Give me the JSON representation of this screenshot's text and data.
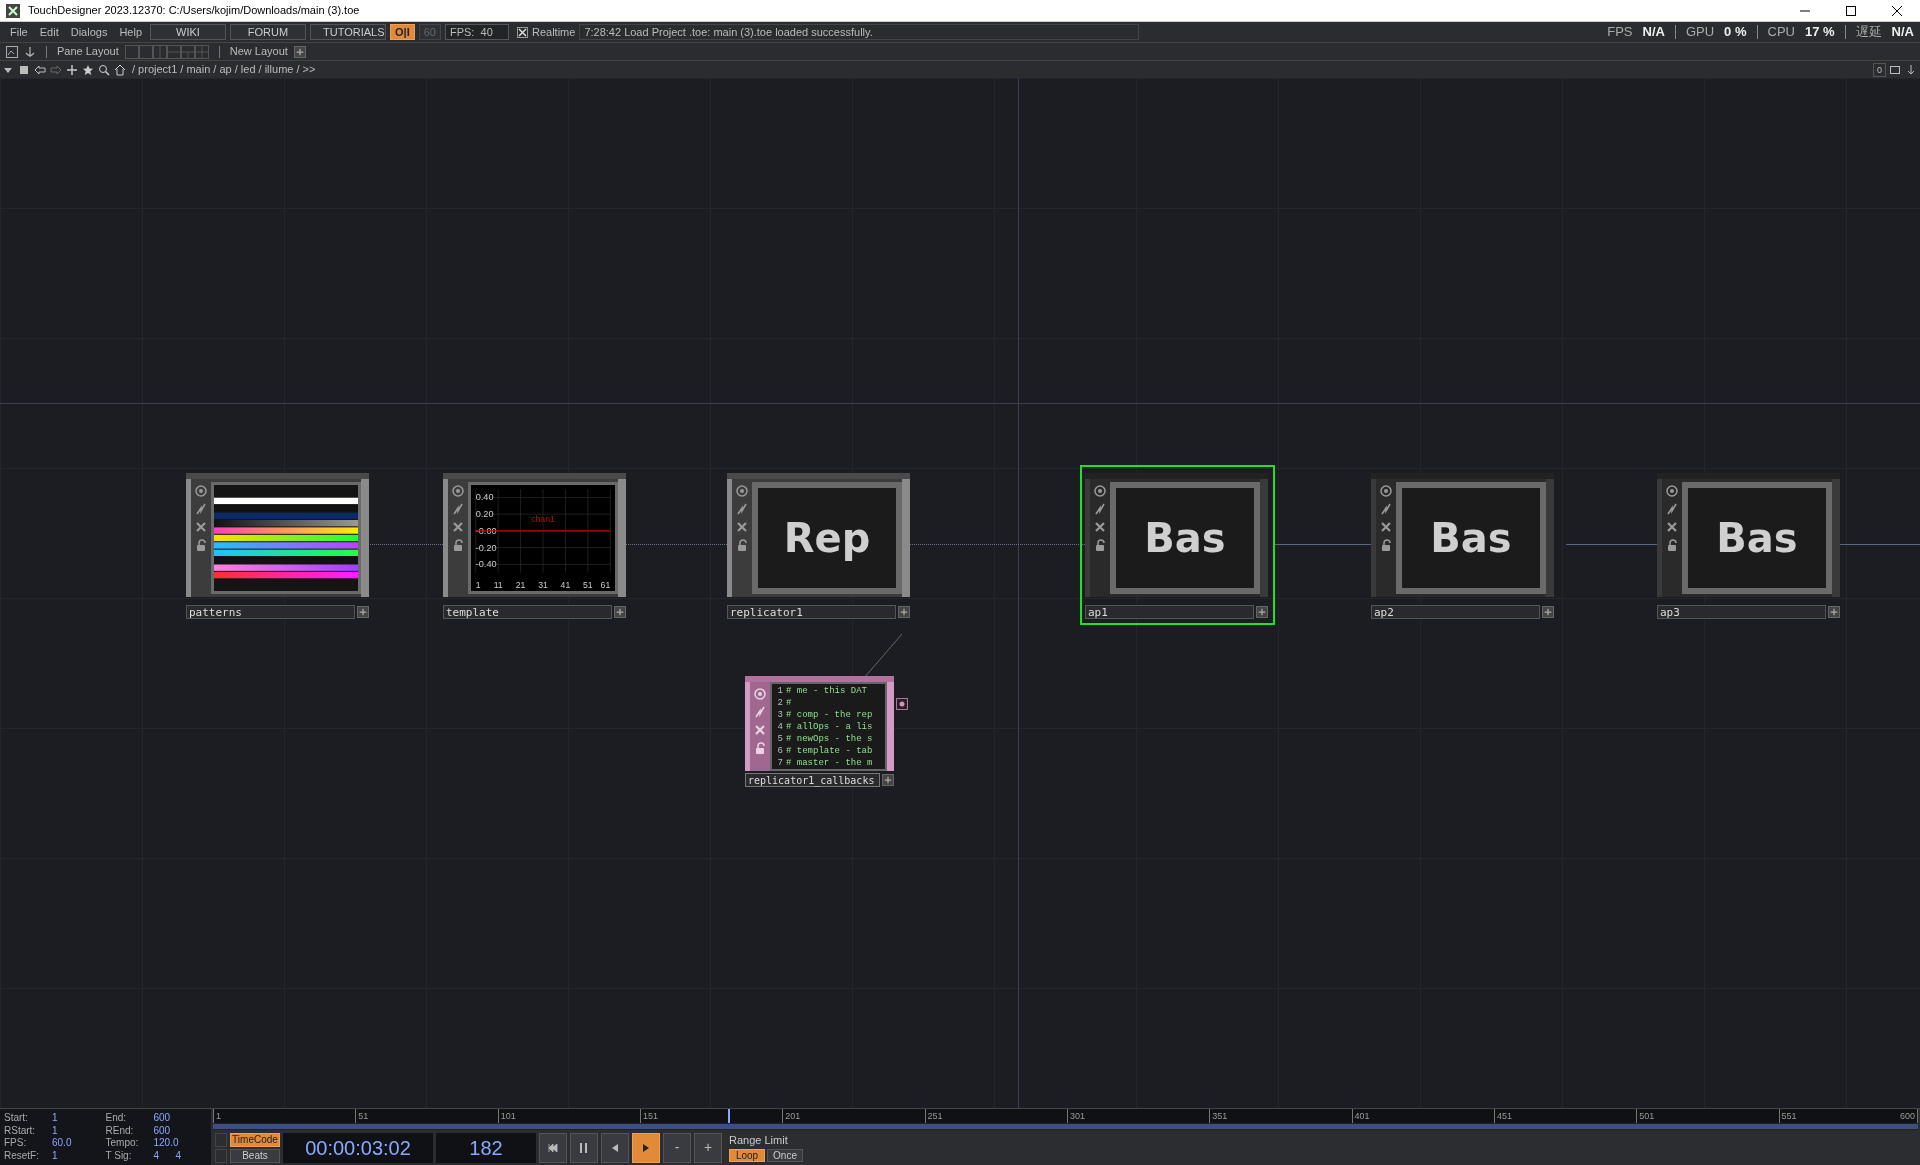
{
  "window": {
    "title": "TouchDesigner 2023.12370: C:/Users/kojim/Downloads/main (3).toe"
  },
  "menu": [
    {
      "label": "File"
    },
    {
      "label": "Edit"
    },
    {
      "label": "Dialogs"
    },
    {
      "label": "Help"
    }
  ],
  "links": [
    "WIKI",
    "FORUM",
    "TUTORIALS"
  ],
  "toggles": [
    {
      "label": "O|I",
      "selected": true
    },
    {
      "label": "60",
      "selected": false
    }
  ],
  "fps_field": "FPS:  40",
  "realtime": {
    "label": "Realtime",
    "checked": true
  },
  "status": "7:28:42 Load Project .toe: main (3).toe loaded successfully.",
  "perf": [
    {
      "label": "FPS",
      "value": "N/A"
    },
    {
      "label": "GPU",
      "value": "0 %"
    },
    {
      "label": "CPU",
      "value": "17 %"
    },
    {
      "label": "遅延",
      "value": "N/A"
    }
  ],
  "pane_layout": {
    "label": "Pane Layout",
    "new_layout": "New Layout"
  },
  "path_bar": {
    "path": "/ project1 / main / ap / led / illume / >>",
    "counter": "0"
  },
  "nodes": [
    {
      "kind": "top",
      "name": "patterns",
      "selected": false
    },
    {
      "kind": "chop",
      "name": "template",
      "selected": false,
      "chart_data": {
        "type": "line",
        "grid": true,
        "x": [
          1,
          61
        ],
        "series": [
          {
            "name": "chan1",
            "color": "#cc0000",
            "values": [
              0,
              0
            ]
          }
        ],
        "xlim": [
          1,
          61
        ],
        "ylim": [
          -0.5,
          0.5
        ],
        "xticks": [
          1,
          11,
          21,
          31,
          41,
          51,
          61
        ],
        "yticks": [
          {
            "value": 0.4,
            "label": "0.40"
          },
          {
            "value": 0.2,
            "label": "0.20"
          },
          {
            "value": 0,
            "label": "-0.00"
          },
          {
            "value": -0.2,
            "label": "-0.20"
          },
          {
            "value": -0.4,
            "label": "-0.40"
          }
        ]
      }
    },
    {
      "kind": "comp",
      "name": "replicator1",
      "text": "Rep",
      "selected": false
    },
    {
      "kind": "base",
      "name": "ap1",
      "text": "Bas",
      "selected": true
    },
    {
      "kind": "base",
      "name": "ap2",
      "text": "Bas",
      "selected": false
    },
    {
      "kind": "base",
      "name": "ap3",
      "text": "Bas",
      "selected": false
    }
  ],
  "callbacks": {
    "name": "replicator1_callbacks",
    "lines": [
      {
        "number": "1",
        "text": "# me - this DAT"
      },
      {
        "number": "2",
        "text": "#"
      },
      {
        "number": "3",
        "text": "# comp - the rep"
      },
      {
        "number": "4",
        "text": "# allOps - a lis"
      },
      {
        "number": "5",
        "text": "# newOps - the s"
      },
      {
        "number": "6",
        "text": "# template - tab"
      },
      {
        "number": "7",
        "text": "# master - the m"
      }
    ]
  },
  "timeline": {
    "info": [
      {
        "label": "Start:",
        "values": [
          "1"
        ]
      },
      {
        "label": "End:",
        "values": [
          "600"
        ]
      },
      {
        "label": "RStart:",
        "values": [
          "1"
        ]
      },
      {
        "label": "REnd:",
        "values": [
          "600"
        ]
      },
      {
        "label": "FPS:",
        "values": [
          "60.0"
        ]
      },
      {
        "label": "Tempo:",
        "values": [
          "120.0"
        ]
      },
      {
        "label": "ResetF:",
        "values": [
          "1"
        ]
      },
      {
        "label": "T Sig:",
        "values": [
          "4",
          "4"
        ]
      }
    ],
    "ruler": [
      "1",
      "51",
      "101",
      "151",
      "201",
      "251",
      "301",
      "351",
      "401",
      "451",
      "501",
      "551",
      "600"
    ],
    "playhead": {
      "level": 0.302
    },
    "modes": [
      {
        "label": "TimeCode",
        "selected": true
      },
      {
        "label": "Beats",
        "selected": false
      }
    ],
    "timecode": "00:00:03:02",
    "frame": "182",
    "transport": [
      {
        "kind": "start",
        "selected": false
      },
      {
        "kind": "pause",
        "selected": false
      },
      {
        "kind": "back",
        "selected": false
      },
      {
        "kind": "play",
        "selected": true
      },
      {
        "kind": "text",
        "label": "-",
        "selected": false
      },
      {
        "kind": "text",
        "label": "+",
        "selected": false
      }
    ],
    "range": {
      "label": "Range Limit",
      "options": [
        {
          "label": "Loop",
          "selected": true
        },
        {
          "label": "Once",
          "selected": false
        }
      ]
    }
  }
}
